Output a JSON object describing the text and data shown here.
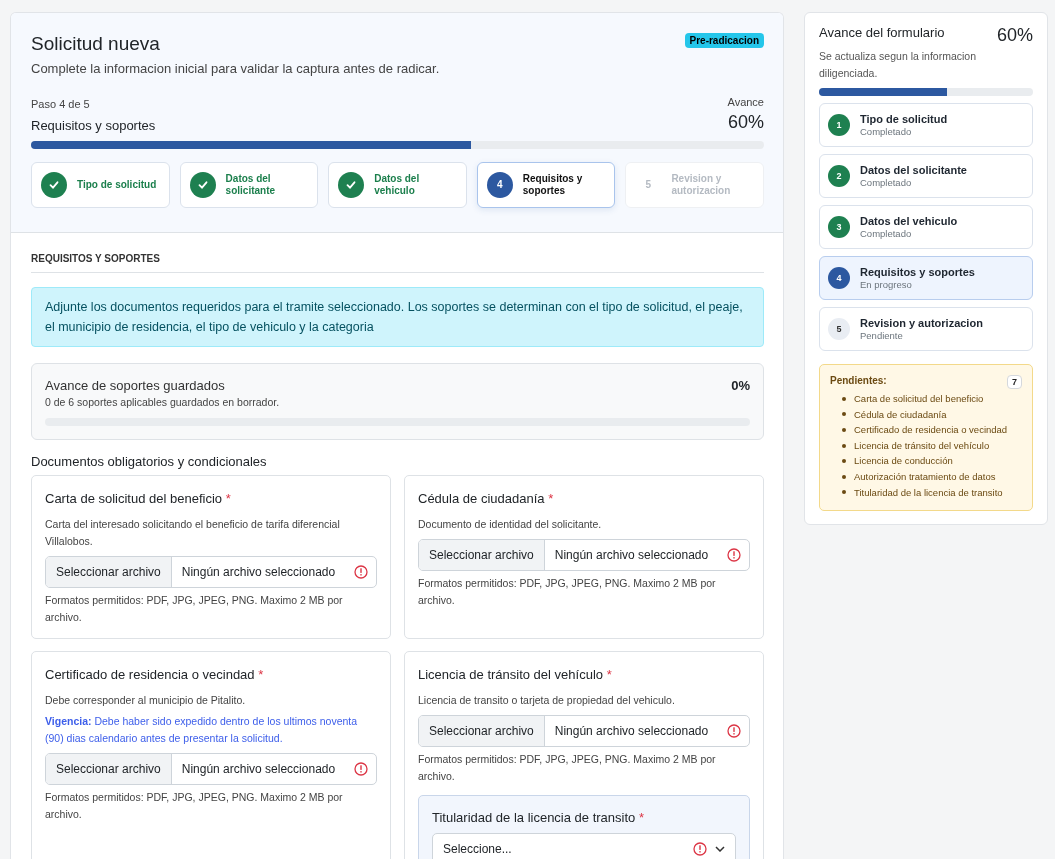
{
  "header": {
    "title": "Solicitud nueva",
    "badge": "Pre-radicacion",
    "subtitle": "Complete la informacion inicial para validar la captura antes de radicar.",
    "step_caption": "Paso 4 de 5",
    "step_title": "Requisitos y soportes",
    "progress_caption": "Avance",
    "progress_value": "60%",
    "level": 0.6
  },
  "steps": [
    {
      "label": "Tipo de solicitud",
      "completed": true,
      "selected": false
    },
    {
      "label": "Datos del solicitante",
      "completed": true,
      "selected": false
    },
    {
      "label": "Datos del vehiculo",
      "completed": true,
      "selected": false
    },
    {
      "number": "4",
      "label": "Requisitos y soportes",
      "completed": false,
      "selected": true
    },
    {
      "number": "5",
      "label": "Revision y autorizacion",
      "completed": false,
      "selected": false
    }
  ],
  "section": {
    "title": "REQUISITOS Y SOPORTES",
    "info": "Adjunte los documentos requeridos para el tramite seleccionado. Los soportes se determinan con el tipo de solicitud, el peaje, el municipio de residencia, el tipo de vehiculo y la categoria",
    "saved": {
      "title": "Avance de soportes guardados",
      "detail": "0 de 6 soportes aplicables guardados en borrador.",
      "value": "0%",
      "level": 0
    },
    "documents_title": "Documentos obligatorios y condicionales",
    "documents": [
      {
        "title": "Carta de solicitud del beneficio",
        "required_mark": "*",
        "description": "Carta del interesado solicitando el beneficio de tarifa diferencial Villalobos.",
        "button": "Seleccionar archivo",
        "file_status": "Ningún archivo seleccionado",
        "invalid": true,
        "hint": "Formatos permitidos: PDF, JPG, JPEG, PNG. Maximo 2 MB por archivo."
      },
      {
        "title": "Cédula de ciudadanía",
        "required_mark": "*",
        "description": "Documento de identidad del solicitante.",
        "button": "Seleccionar archivo",
        "file_status": "Ningún archivo seleccionado",
        "invalid": true,
        "hint": "Formatos permitidos: PDF, JPG, JPEG, PNG. Maximo 2 MB por archivo."
      },
      {
        "title": "Certificado de residencia o vecindad",
        "required_mark": "*",
        "description": "Debe corresponder al municipio de Pitalito.",
        "note": "**Vigencia:** Debe haber sido expedido dentro de los ultimos noventa (90) dias calendario antes de presentar la solicitud.",
        "button": "Seleccionar archivo",
        "file_status": "Ningún archivo seleccionado",
        "invalid": true,
        "hint": "Formatos permitidos: PDF, JPG, JPEG, PNG. Maximo 2 MB por archivo."
      },
      {
        "title": "Licencia de tránsito del vehículo",
        "required_mark": "*",
        "description": "Licencia de transito o tarjeta de propiedad del vehiculo.",
        "button": "Seleccionar archivo",
        "file_status": "Ningún archivo seleccionado",
        "invalid": true,
        "hint": "Formatos permitidos: PDF, JPG, JPEG, PNG. Maximo 2 MB por archivo.",
        "sub_field": {
          "label": "Titularidad de la licencia de transito",
          "required_mark": "*",
          "value": "Seleccione...",
          "invalid": true
        }
      }
    ]
  },
  "sidebar": {
    "title": "Avance del formulario",
    "value": "60%",
    "subtitle": "Se actualiza segun la informacion diligenciada.",
    "level": 0.6,
    "steps": [
      {
        "number": "1",
        "title": "Tipo de solicitud",
        "status_text": "Completado",
        "completed": true,
        "selected": false
      },
      {
        "number": "2",
        "title": "Datos del solicitante",
        "status_text": "Completado",
        "completed": true,
        "selected": false
      },
      {
        "number": "3",
        "title": "Datos del vehiculo",
        "status_text": "Completado",
        "completed": true,
        "selected": false
      },
      {
        "number": "4",
        "title": "Requisitos y soportes",
        "status_text": "En progreso",
        "completed": false,
        "selected": true
      },
      {
        "number": "5",
        "title": "Revision y autorizacion",
        "status_text": "Pendiente",
        "completed": false,
        "selected": false
      }
    ],
    "pending": {
      "title": "Pendientes:",
      "count": "7",
      "items": [
        "Carta de solicitud del beneficio",
        "Cédula de ciudadanía",
        "Certificado de residencia o vecindad",
        "Licencia de tránsito del vehículo",
        "Licencia de conducción",
        "Autorización tratamiento de datos",
        "Titularidad de la licencia de transito"
      ]
    }
  }
}
